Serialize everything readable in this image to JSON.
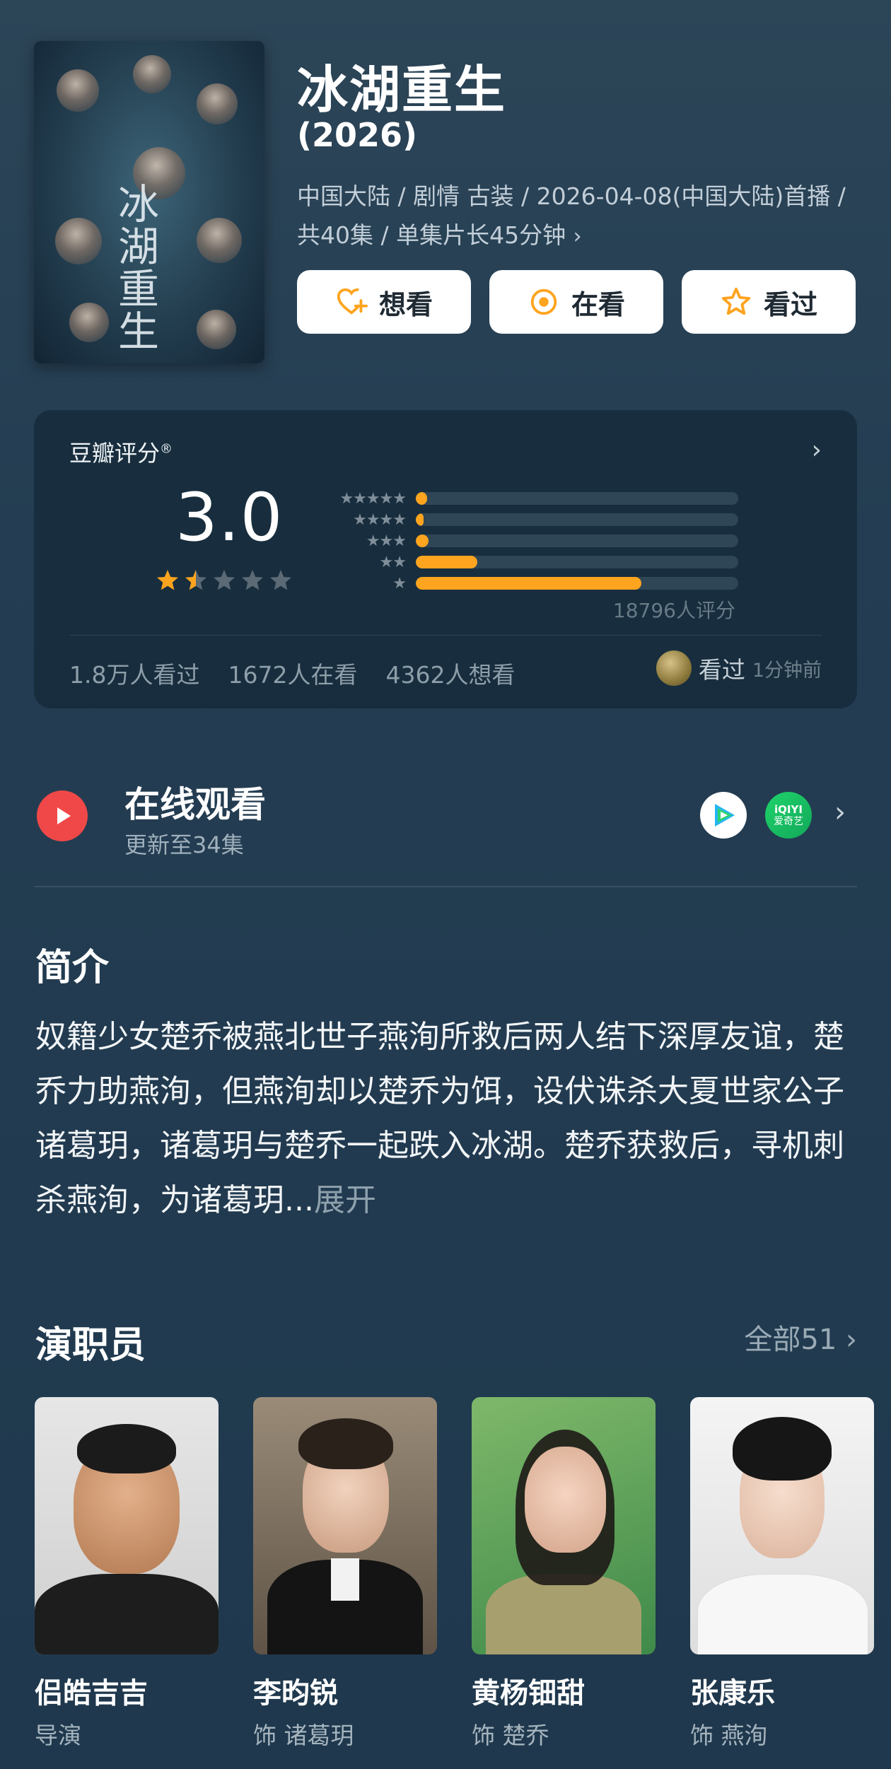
{
  "header": {
    "title": "冰湖重生",
    "year": "(2026)",
    "meta": "中国大陆 / 剧情 古装 / 2026-04-08(中国大陆)首播 / 共40集 / 单集片长45分钟",
    "meta_chevron": "›",
    "poster_calligraphy": "冰湖重生",
    "actions": [
      {
        "label": "想看",
        "icon": "heart-plus-icon"
      },
      {
        "label": "在看",
        "icon": "target-icon"
      },
      {
        "label": "看过",
        "icon": "star-outline-icon"
      }
    ]
  },
  "rating": {
    "label": "豆瓣评分",
    "label_mark": "®",
    "score": "3.0",
    "score_stars": 1.5,
    "distribution": [
      {
        "stars": 5,
        "glyphs": "★★★★★",
        "fraction": 0.035
      },
      {
        "stars": 4,
        "glyphs": "★★★★",
        "fraction": 0.025
      },
      {
        "stars": 3,
        "glyphs": "★★★",
        "fraction": 0.04
      },
      {
        "stars": 2,
        "glyphs": "★★",
        "fraction": 0.19
      },
      {
        "stars": 1,
        "glyphs": "★",
        "fraction": 0.7
      }
    ],
    "count_text": "18796人评分",
    "stats": [
      "1.8万人看过",
      "1672人在看",
      "4362人想看"
    ],
    "recent_action": "看过",
    "recent_time": "1分钟前",
    "star_color": "#ffa41f"
  },
  "online": {
    "title": "在线观看",
    "subtitle": "更新至34集",
    "platforms": [
      {
        "name": "tencent-video-icon",
        "label": ""
      },
      {
        "name": "iqiyi-icon",
        "label": "iQIYI",
        "sublabel": "爱奇艺"
      }
    ]
  },
  "intro": {
    "title": "简介",
    "text": "奴籍少女楚乔被燕北世子燕洵所救后两人结下深厚友谊，楚乔力助燕洵，但燕洵却以楚乔为饵，设伏诛杀大夏世家公子诸葛玥，诸葛玥与楚乔一起跌入冰湖。楚乔获救后，寻机刺杀燕洵，为诸葛玥...",
    "expand": "展开"
  },
  "cast": {
    "title": "演职员",
    "all_label": "全部51",
    "members": [
      {
        "name": "侣皓吉吉",
        "role": "导演"
      },
      {
        "name": "李昀锐",
        "role": "饰 诸葛玥"
      },
      {
        "name": "黄杨钿甜",
        "role": "饰 楚乔"
      },
      {
        "name": "张康乐",
        "role": "饰 燕洵"
      }
    ]
  },
  "chevron": "›"
}
